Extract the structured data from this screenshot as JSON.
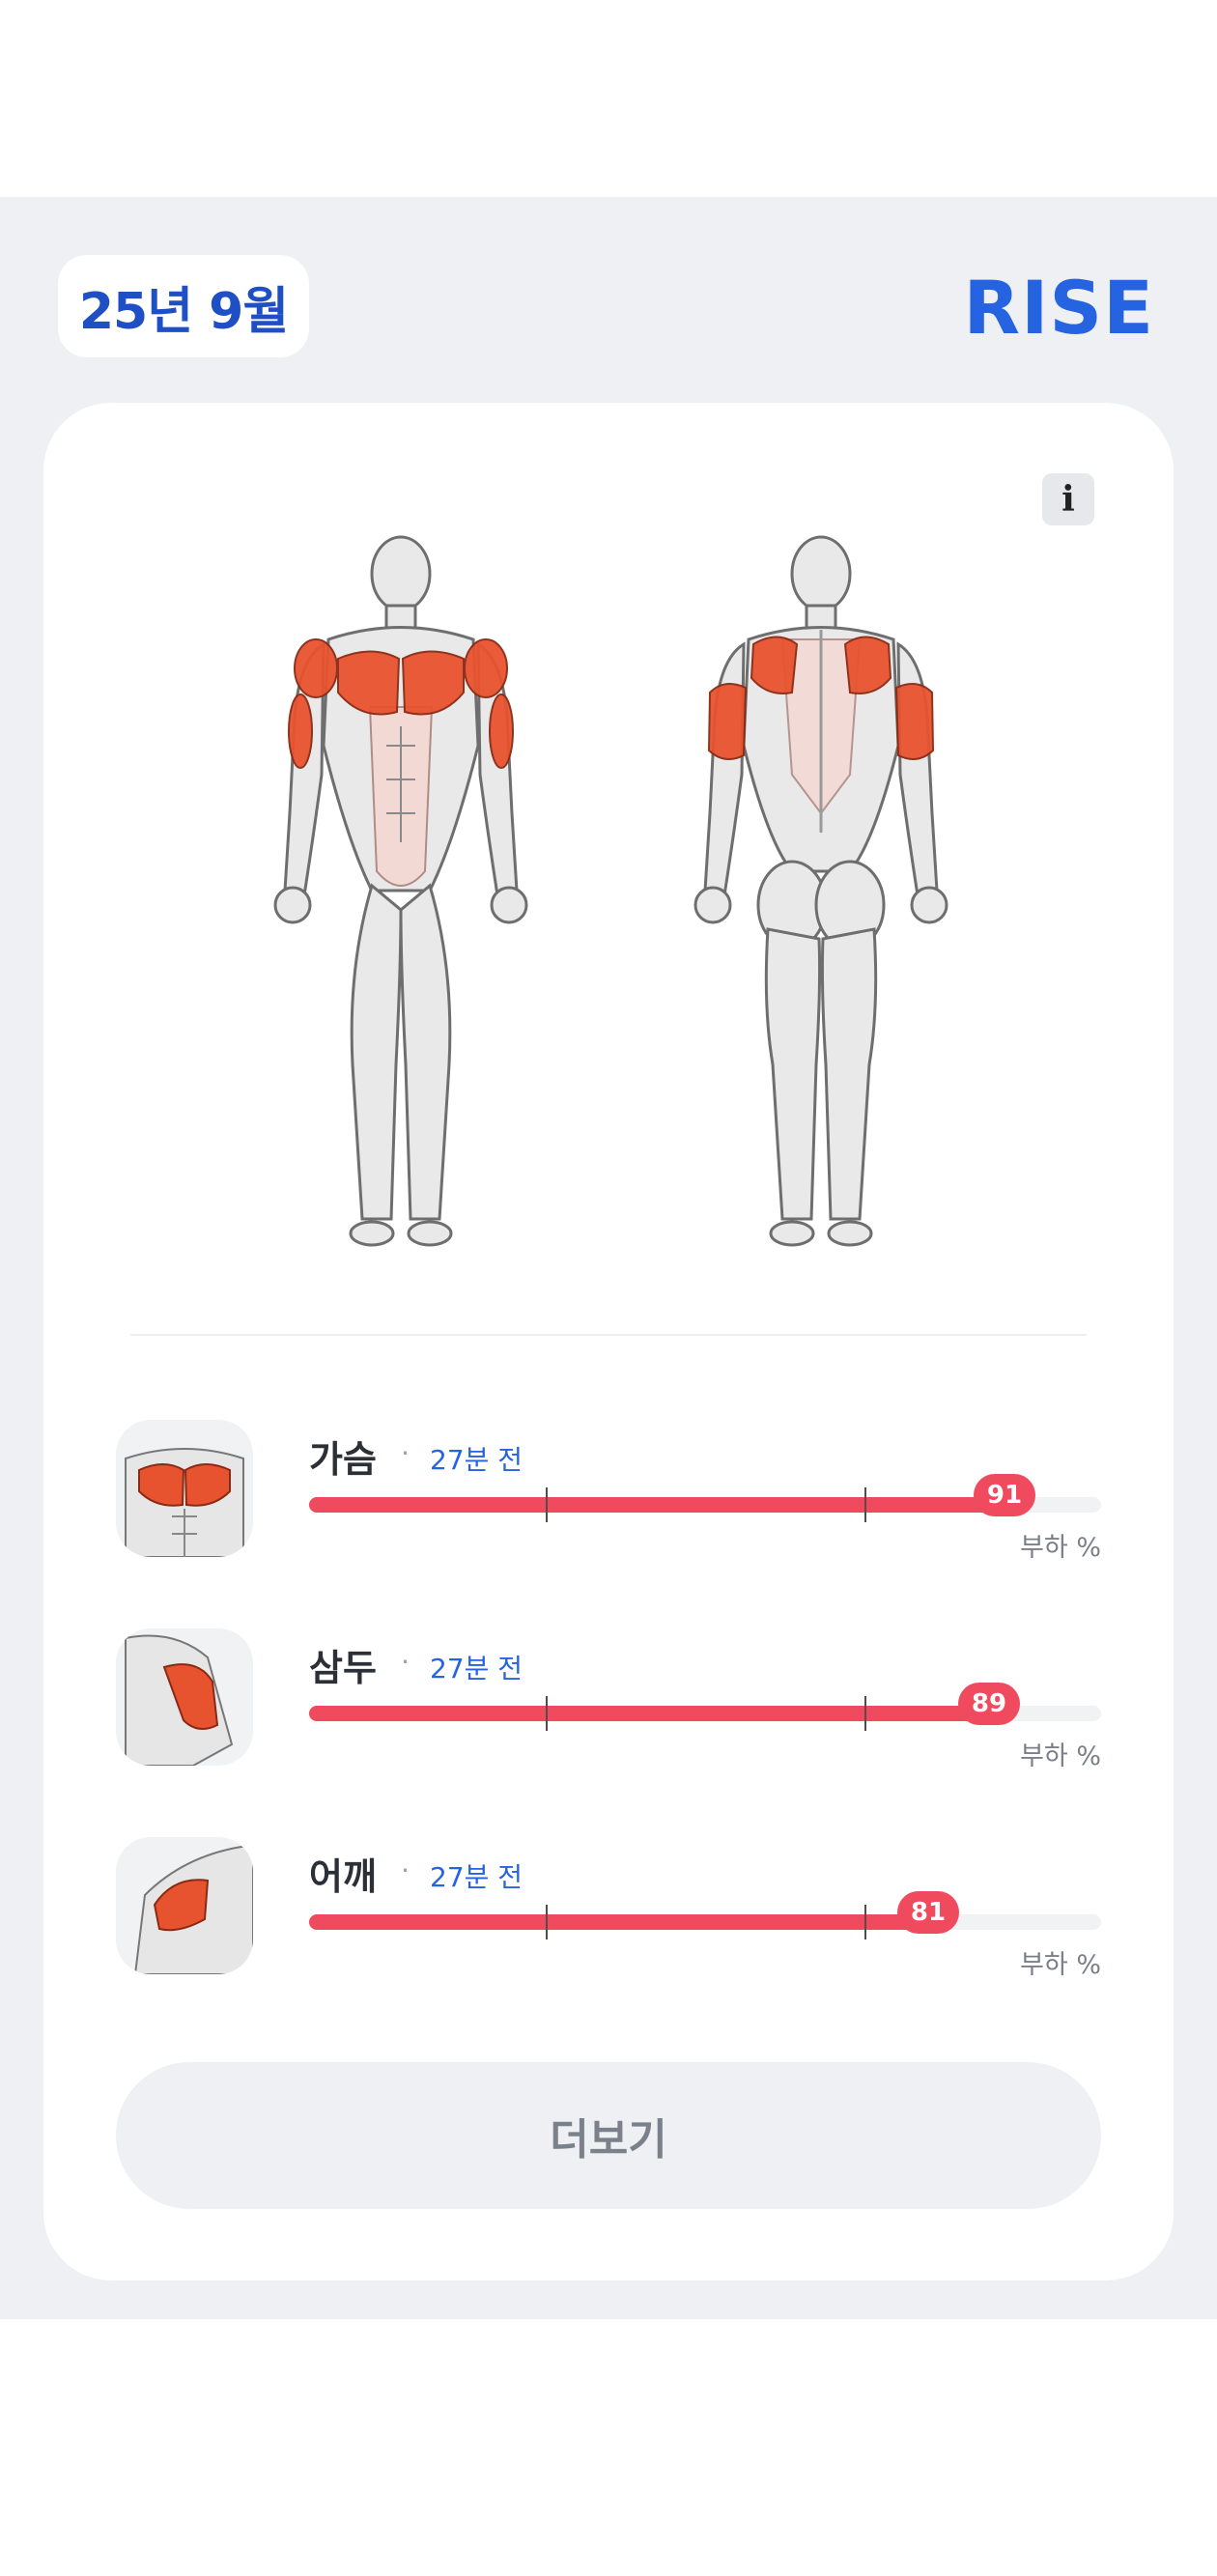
{
  "header": {
    "date": "25년 9월",
    "brand": "RISE"
  },
  "info_button": {
    "label": "i"
  },
  "muscles": [
    {
      "name": "가슴",
      "time": "27분 전",
      "load": 91,
      "unit": "부하 %"
    },
    {
      "name": "삼두",
      "time": "27분 전",
      "load": 89,
      "unit": "부하 %"
    },
    {
      "name": "어깨",
      "time": "27분 전",
      "load": 81,
      "unit": "부하 %"
    }
  ],
  "more_button": {
    "label": "더보기"
  },
  "colors": {
    "accent": "#2563e0",
    "date_text": "#1f4fc4",
    "load_bar": "#ef4a5e",
    "muscle_highlight": "#e8532f",
    "background_band": "#eef0f3"
  }
}
